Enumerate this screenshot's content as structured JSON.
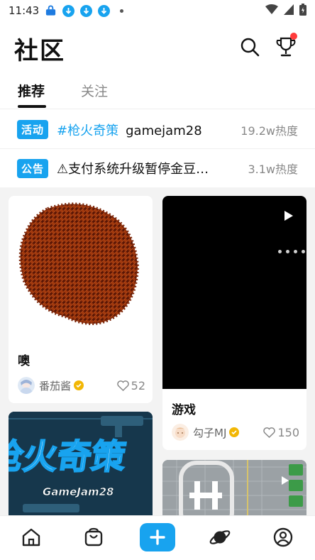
{
  "status_bar": {
    "time": "11:43"
  },
  "header": {
    "title": "社区"
  },
  "tabs": [
    {
      "label": "推荐",
      "active": true
    },
    {
      "label": "关注",
      "active": false
    }
  ],
  "notices": [
    {
      "badge": "活动",
      "tag": "#枪火奇策",
      "text": "gamejam28",
      "heat": "19.2w热度"
    },
    {
      "badge": "公告",
      "tag": "",
      "text": "⚠支付系统升级暂停金豆…",
      "heat": "3.1w热度"
    }
  ],
  "posts": [
    {
      "title": "噢",
      "author": "番茄酱",
      "likes": "52",
      "media": "image"
    },
    {
      "title": "游戏",
      "author": "勾子MJ",
      "likes": "150",
      "media": "video"
    },
    {
      "title": "",
      "author": "",
      "likes": "",
      "media": "image",
      "art_text": "枪火奇策",
      "art_subtext": "GameJam28"
    },
    {
      "title": "",
      "author": "",
      "likes": "",
      "media": "video"
    }
  ],
  "colors": {
    "accent": "#18a3ef",
    "notification": "#ff3b3b",
    "verified": "#f2b705"
  },
  "icons": {
    "search": "search-icon",
    "trophy": "trophy-icon",
    "home": "home-icon",
    "shop": "shopping-bag-icon",
    "add": "plus-icon",
    "planet": "planet-icon",
    "profile": "profile-icon"
  }
}
